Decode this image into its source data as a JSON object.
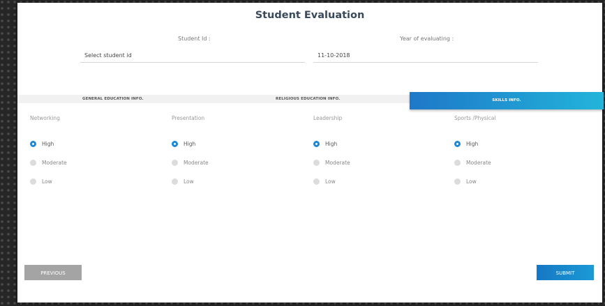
{
  "page": {
    "title": "Student Evaluation"
  },
  "form": {
    "student_id": {
      "label": "Student Id :",
      "placeholder": "Select student id",
      "value": ""
    },
    "year": {
      "label": "Year of evaluating :",
      "value": "11-10-2018"
    }
  },
  "tabs": [
    {
      "label": "GENERAL EDUCATION INFO.",
      "active": false
    },
    {
      "label": "RELIGIOUS EDUCATION INFO.",
      "active": false
    },
    {
      "label": "SKILLS INFO.",
      "active": true
    }
  ],
  "skills": [
    {
      "name": "Networking",
      "options": [
        "High",
        "Moderate",
        "Low"
      ],
      "selected": "High"
    },
    {
      "name": "Presentation",
      "options": [
        "High",
        "Moderate",
        "Low"
      ],
      "selected": "High"
    },
    {
      "name": "Leadership",
      "options": [
        "High",
        "Moderate",
        "Low"
      ],
      "selected": "High"
    },
    {
      "name": "Sports /Physical",
      "options": [
        "High",
        "Moderate",
        "Low"
      ],
      "selected": "High"
    }
  ],
  "buttons": {
    "previous": "PREVIOUS",
    "submit": "SUBMIT"
  },
  "colors": {
    "accent": "#1e88d8",
    "tab_gradient_start": "#1e78c8",
    "tab_gradient_end": "#22b4da",
    "button_grey": "#a4a4a4"
  }
}
